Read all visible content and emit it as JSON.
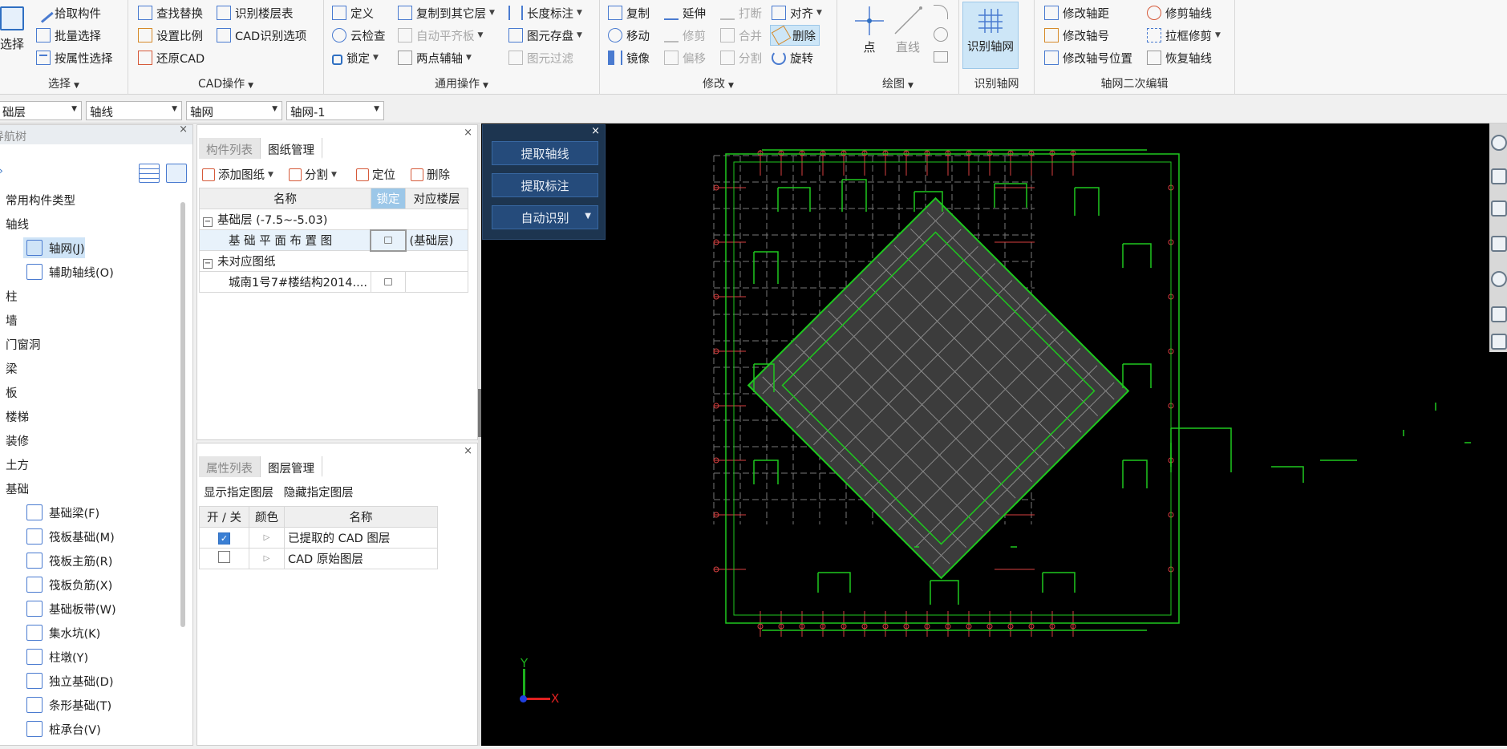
{
  "ribbon": {
    "select_group": {
      "big_label": "选择",
      "items": [
        "拾取构件",
        "批量选择",
        "按属性选择"
      ],
      "title": "选择"
    },
    "cad_group": {
      "items": [
        "查找替换",
        "识别楼层表",
        "设置比例",
        "CAD识别选项",
        "还原CAD"
      ],
      "title": "CAD操作"
    },
    "common_group": {
      "items": [
        "定义",
        "复制到其它层",
        "长度标注",
        "云检查",
        "自动平齐板",
        "图元存盘",
        "锁定",
        "两点辅轴",
        "图元过滤"
      ],
      "title": "通用操作"
    },
    "modify_group": {
      "items": [
        "复制",
        "延伸",
        "打断",
        "对齐",
        "移动",
        "修剪",
        "合并",
        "删除",
        "镜像",
        "偏移",
        "分割",
        "旋转"
      ],
      "title": "修改"
    },
    "draw_group": {
      "point": "点",
      "line": "直线",
      "title": "绘图"
    },
    "identify_group": {
      "big_label": "识别轴网",
      "title": "识别轴网"
    },
    "axis_edit_group": {
      "items": [
        "修改轴距",
        "修剪轴线",
        "修改轴号",
        "拉框修剪",
        "修改轴号位置",
        "恢复轴线"
      ],
      "title": "轴网二次编辑"
    }
  },
  "layerbar": {
    "floor": "础层",
    "category": "轴线",
    "type": "轴网",
    "instance": "轴网-1"
  },
  "nav": {
    "title": "导航树",
    "items": [
      {
        "label": "常用构件类型",
        "indent": false
      },
      {
        "label": "轴线",
        "indent": false
      },
      {
        "label": "轴网(J)",
        "indent": true,
        "selected": true
      },
      {
        "label": "辅助轴线(O)",
        "indent": true
      },
      {
        "label": "柱",
        "indent": false
      },
      {
        "label": "墙",
        "indent": false
      },
      {
        "label": "门窗洞",
        "indent": false
      },
      {
        "label": "梁",
        "indent": false
      },
      {
        "label": "板",
        "indent": false
      },
      {
        "label": "楼梯",
        "indent": false
      },
      {
        "label": "装修",
        "indent": false
      },
      {
        "label": "土方",
        "indent": false
      },
      {
        "label": "基础",
        "indent": false
      },
      {
        "label": "基础梁(F)",
        "indent": true
      },
      {
        "label": "筏板基础(M)",
        "indent": true
      },
      {
        "label": "筏板主筋(R)",
        "indent": true
      },
      {
        "label": "筏板负筋(X)",
        "indent": true
      },
      {
        "label": "基础板带(W)",
        "indent": true
      },
      {
        "label": "集水坑(K)",
        "indent": true
      },
      {
        "label": "柱墩(Y)",
        "indent": true
      },
      {
        "label": "独立基础(D)",
        "indent": true
      },
      {
        "label": "条形基础(T)",
        "indent": true
      },
      {
        "label": "桩承台(V)",
        "indent": true
      }
    ]
  },
  "drawing_panel": {
    "tabs": [
      "构件列表",
      "图纸管理"
    ],
    "toolbar": {
      "add": "添加图纸",
      "split": "分割",
      "locate": "定位",
      "delete": "删除"
    },
    "columns": {
      "name": "名称",
      "lock": "锁定",
      "floor": "对应楼层"
    },
    "rows": [
      {
        "name": "基础层 (-7.5~-5.03)",
        "group": true
      },
      {
        "name": "基 础 平 面 布 置 图",
        "floor": "(基础层)",
        "selected": true
      },
      {
        "name": "未对应图纸",
        "group": true
      },
      {
        "name": "城南1号7#楼结构2014....",
        "floor": ""
      }
    ]
  },
  "layer_panel": {
    "tabs": [
      "属性列表",
      "图层管理"
    ],
    "toolbar": {
      "show": "显示指定图层",
      "hide": "隐藏指定图层"
    },
    "columns": {
      "toggle": "开 / 关",
      "color": "颜色",
      "name": "名称"
    },
    "rows": [
      {
        "checked": true,
        "name": "已提取的 CAD 图层"
      },
      {
        "checked": false,
        "name": "CAD 原始图层"
      }
    ]
  },
  "cad_popup": {
    "extract_axis": "提取轴线",
    "extract_label": "提取标注",
    "auto_identify": "自动识别"
  },
  "axes": {
    "y": "Y",
    "x": "X"
  }
}
